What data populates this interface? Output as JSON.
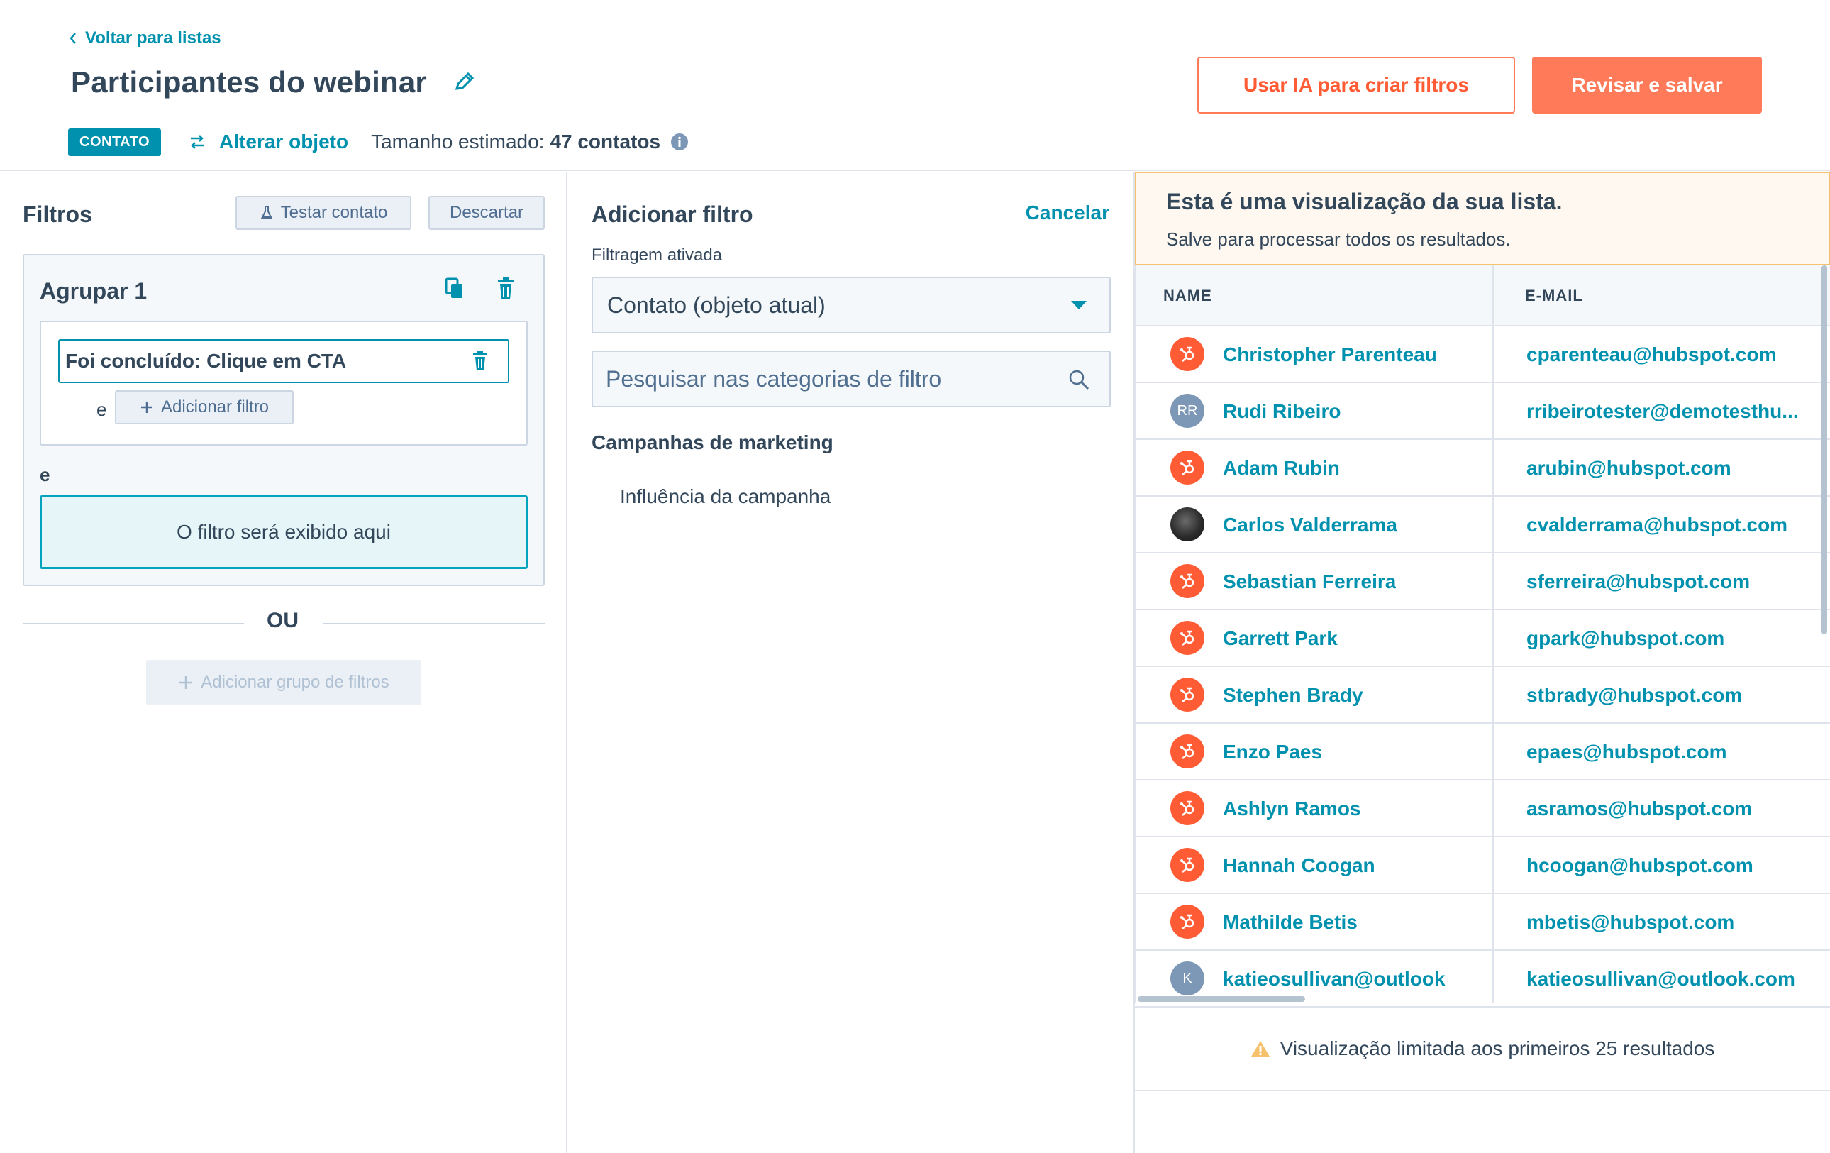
{
  "header": {
    "back_label": "Voltar para listas",
    "title": "Participantes do webinar",
    "ai_button": "Usar IA para criar filtros",
    "save_button": "Revisar e salvar",
    "object_badge": "CONTATO",
    "change_object": "Alterar objeto",
    "size_label": "Tamanho estimado:",
    "size_value": "47 contatos"
  },
  "filters": {
    "title": "Filtros",
    "test_button": "Testar contato",
    "discard_button": "Descartar",
    "group_title": "Agrupar 1",
    "active_filter": "Foi concluído: Clique em CTA",
    "and_inner": "e",
    "add_filter": "Adicionar filtro",
    "and_outer": "e",
    "placeholder": "O filtro será exibido aqui",
    "or_label": "OU",
    "add_group": "Adicionar grupo de filtros"
  },
  "add_filter_panel": {
    "title": "Adicionar filtro",
    "cancel": "Cancelar",
    "filtering_label": "Filtragem ativada",
    "selected_object": "Contato (objeto atual)",
    "search_placeholder": "Pesquisar nas categorias de filtro",
    "category_title": "Campanhas de marketing",
    "category_item": "Influência da campanha"
  },
  "preview": {
    "banner_title": "Esta é uma visualização da sua lista.",
    "banner_sub": "Salve para processar todos os resultados.",
    "columns": [
      "NAME",
      "E-MAIL"
    ],
    "rows": [
      {
        "name": "Christopher Parenteau",
        "email": "cparenteau@hubspot.com",
        "avatar": "hubspot"
      },
      {
        "name": "Rudi Ribeiro",
        "email": "rribeirotester@demotesthu...",
        "avatar": "initials",
        "initials": "RR"
      },
      {
        "name": "Adam Rubin",
        "email": "arubin@hubspot.com",
        "avatar": "hubspot"
      },
      {
        "name": "Carlos Valderrama",
        "email": "cvalderrama@hubspot.com",
        "avatar": "photo"
      },
      {
        "name": "Sebastian Ferreira",
        "email": "sferreira@hubspot.com",
        "avatar": "hubspot"
      },
      {
        "name": "Garrett Park",
        "email": "gpark@hubspot.com",
        "avatar": "hubspot"
      },
      {
        "name": "Stephen Brady",
        "email": "stbrady@hubspot.com",
        "avatar": "hubspot"
      },
      {
        "name": "Enzo Paes",
        "email": "epaes@hubspot.com",
        "avatar": "hubspot"
      },
      {
        "name": "Ashlyn Ramos",
        "email": "asramos@hubspot.com",
        "avatar": "hubspot"
      },
      {
        "name": "Hannah Coogan",
        "email": "hcoogan@hubspot.com",
        "avatar": "hubspot"
      },
      {
        "name": "Mathilde Betis",
        "email": "mbetis@hubspot.com",
        "avatar": "hubspot"
      },
      {
        "name": "katieosullivan@outlook",
        "email": "katieosullivan@outlook.com",
        "avatar": "initials",
        "initials": "K"
      }
    ],
    "footer_note": "Visualização limitada aos primeiros 25 resultados"
  },
  "colors": {
    "accent_teal": "#0091ae",
    "accent_orange": "#ff7a59",
    "text_dark": "#33475b",
    "border": "#dfe3eb"
  }
}
